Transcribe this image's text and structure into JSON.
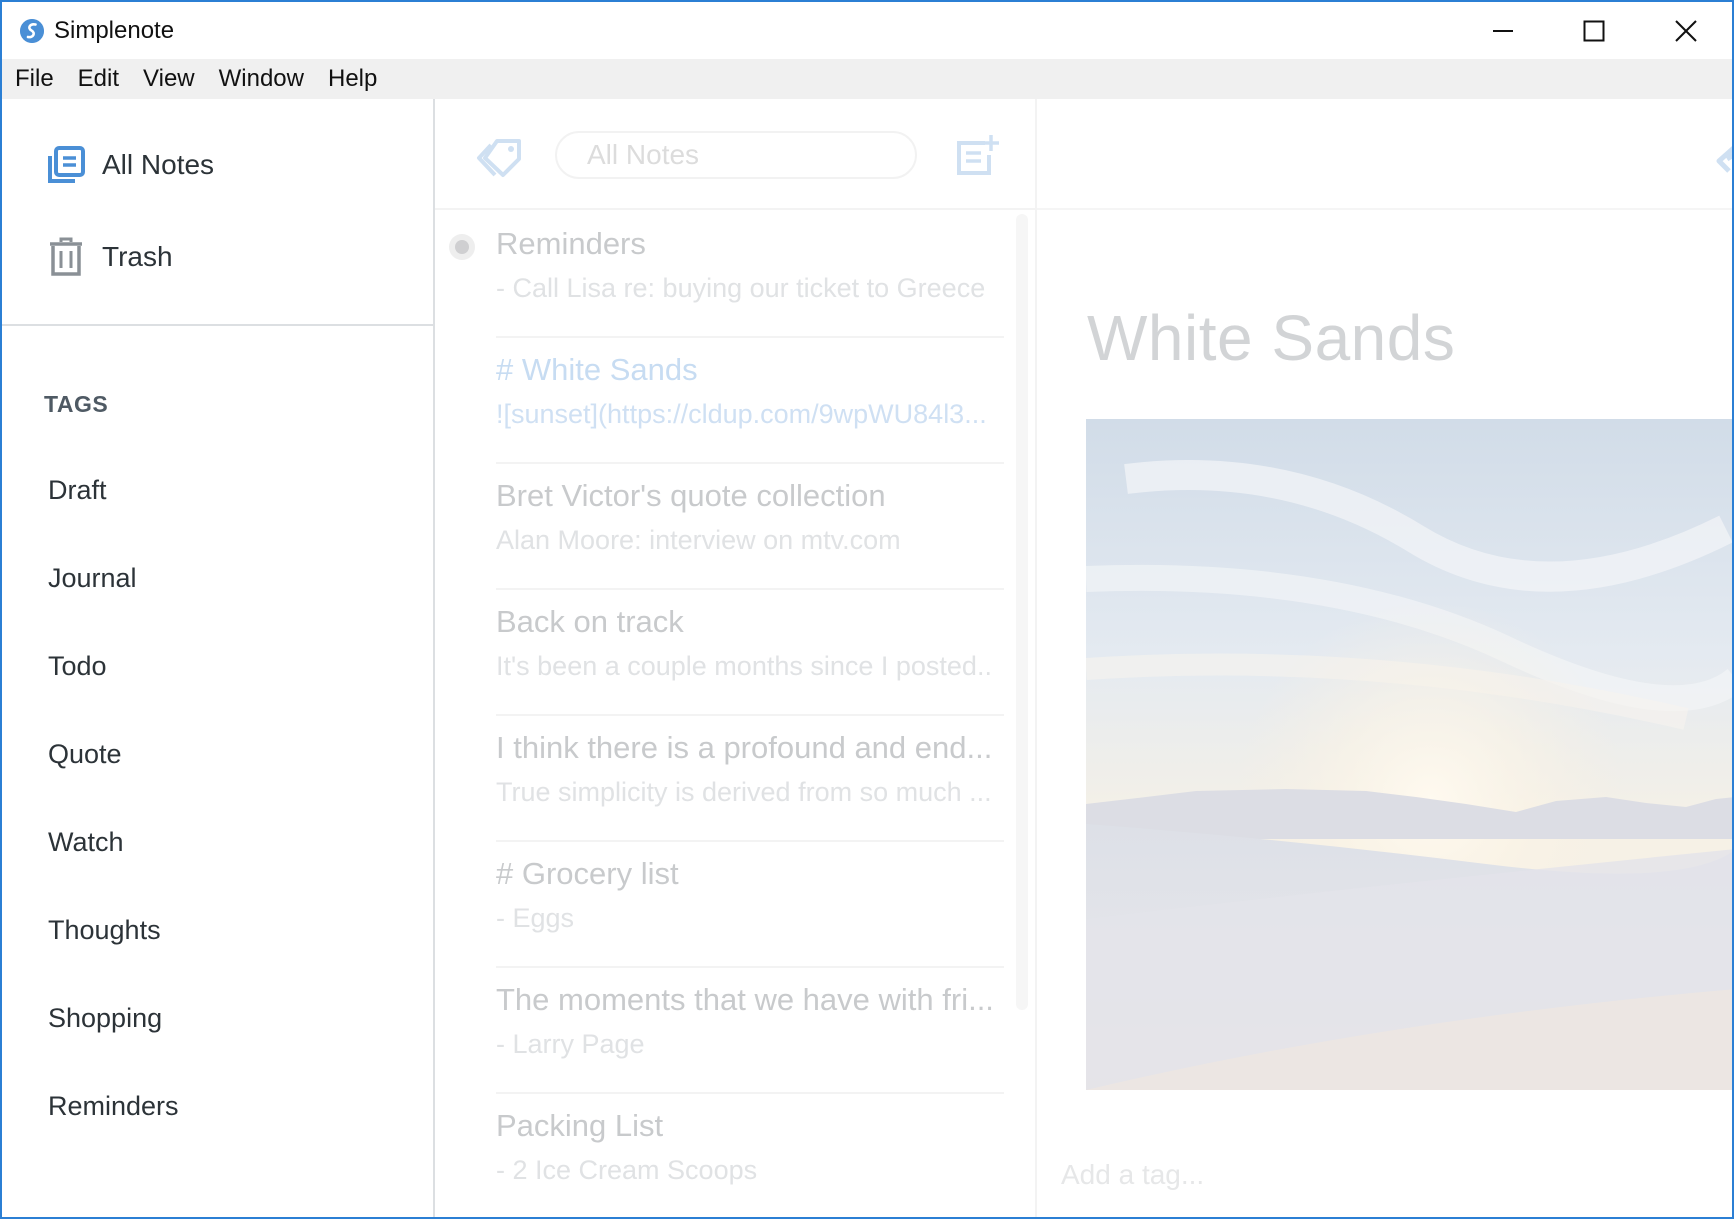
{
  "window": {
    "title": "Simplenote",
    "controls": {
      "minimize": "minimize",
      "maximize": "maximize",
      "close": "close"
    }
  },
  "menu": [
    "File",
    "Edit",
    "View",
    "Window",
    "Help"
  ],
  "sidebar": {
    "nav": [
      {
        "label": "All Notes",
        "icon": "all-notes-icon"
      },
      {
        "label": "Trash",
        "icon": "trash-icon"
      }
    ],
    "tags_heading": "TAGS",
    "tags": [
      "Draft",
      "Journal",
      "Todo",
      "Quote",
      "Watch",
      "Thoughts",
      "Shopping",
      "Reminders"
    ]
  },
  "notelist": {
    "search_placeholder": "All Notes",
    "notes": [
      {
        "title": "Reminders",
        "preview": "- Call Lisa re: buying our ticket to Greece",
        "pinned": true,
        "selected": false
      },
      {
        "title": "# White Sands",
        "preview": "![sunset](https://cldup.com/9wpWU84l3...",
        "pinned": false,
        "selected": true
      },
      {
        "title": "Bret Victor's quote collection",
        "preview": "Alan Moore: interview on mtv.com",
        "pinned": false,
        "selected": false
      },
      {
        "title": "Back on track",
        "preview": "It's been a couple months since I posted..",
        "pinned": false,
        "selected": false
      },
      {
        "title": "I think there is a profound and end...",
        "preview": "True simplicity is derived from so much ...",
        "pinned": false,
        "selected": false
      },
      {
        "title": "# Grocery list",
        "preview": "- Eggs",
        "pinned": false,
        "selected": false
      },
      {
        "title": "The moments that we have with fri...",
        "preview": "- Larry Page",
        "pinned": false,
        "selected": false
      },
      {
        "title": "Packing List",
        "preview": "- 2 Ice Cream Scoops",
        "pinned": false,
        "selected": false
      }
    ]
  },
  "editor": {
    "title": "White Sands",
    "image_alt": "sunset",
    "tag_placeholder": "Add a tag..."
  },
  "colors": {
    "accent": "#4a8fd6",
    "window_border": "#2b7fd4",
    "menubar_bg": "#f0f0f0",
    "selected_note": "#c7dcf2"
  }
}
